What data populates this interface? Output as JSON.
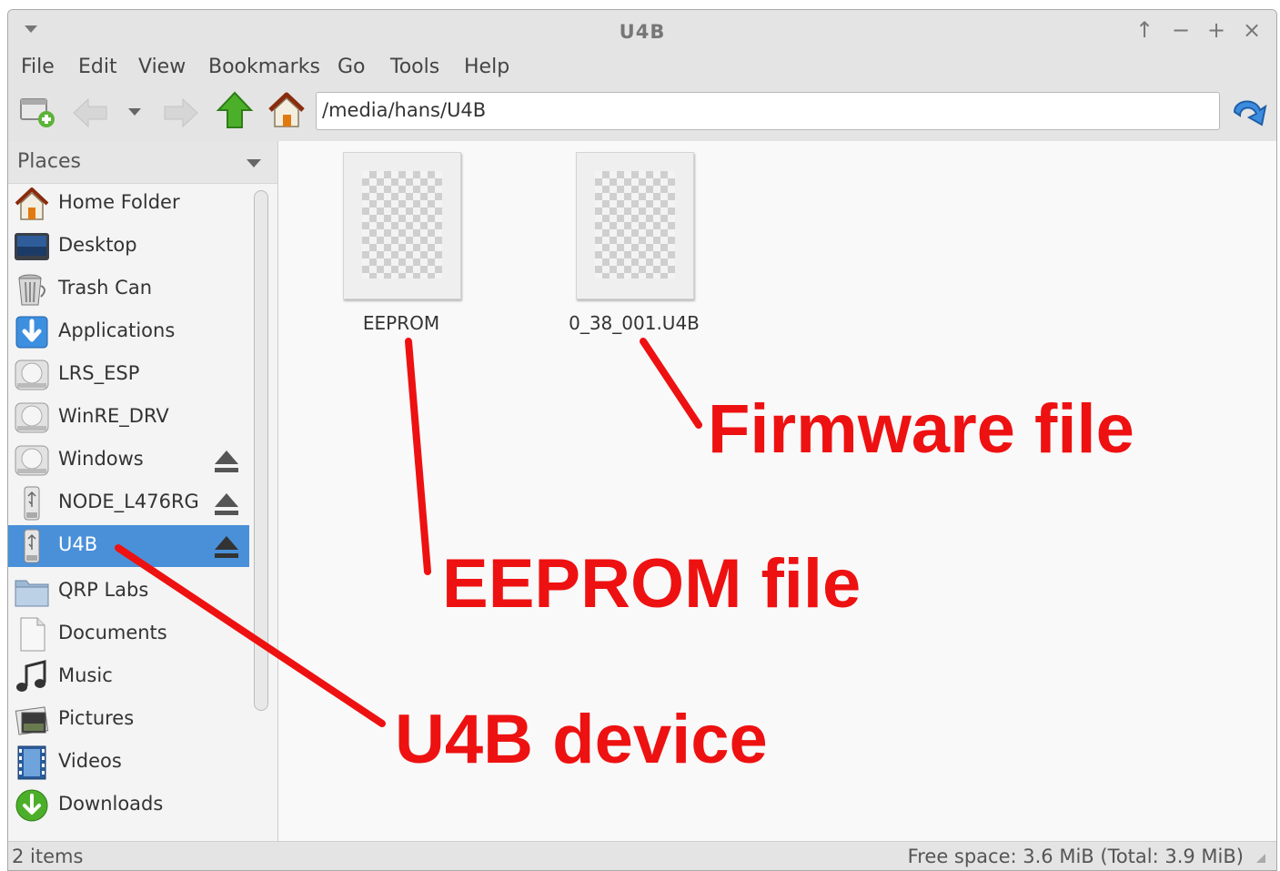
{
  "window": {
    "title": "U4B",
    "controls": [
      "↑",
      "−",
      "+",
      "×"
    ]
  },
  "menu": [
    "File",
    "Edit",
    "View",
    "Bookmarks",
    "Go",
    "Tools",
    "Help"
  ],
  "toolbar": {
    "address": "/media/hans/U4B",
    "icons": [
      "new-tab-icon",
      "back-icon",
      "history-dropdown-icon",
      "forward-icon",
      "up-icon",
      "home-icon",
      "go-icon"
    ]
  },
  "sidebar": {
    "title": "Places",
    "items": [
      {
        "label": "Home Folder",
        "icon": "home-icon"
      },
      {
        "label": "Desktop",
        "icon": "desktop-icon"
      },
      {
        "label": "Trash Can",
        "icon": "trash-icon"
      },
      {
        "label": "Applications",
        "icon": "applications-icon"
      },
      {
        "label": "LRS_ESP",
        "icon": "drive-icon"
      },
      {
        "label": "WinRE_DRV",
        "icon": "drive-icon"
      },
      {
        "label": "Windows",
        "icon": "drive-icon",
        "eject": true
      },
      {
        "label": "NODE_L476RG",
        "icon": "usb-icon",
        "eject": true
      },
      {
        "label": "U4B",
        "icon": "usb-icon",
        "eject": true,
        "selected": true
      },
      {
        "label": "QRP Labs",
        "icon": "folder-icon"
      },
      {
        "label": "Documents",
        "icon": "documents-icon"
      },
      {
        "label": "Music",
        "icon": "music-icon"
      },
      {
        "label": "Pictures",
        "icon": "pictures-icon"
      },
      {
        "label": "Videos",
        "icon": "videos-icon"
      },
      {
        "label": "Downloads",
        "icon": "downloads-icon"
      }
    ]
  },
  "files": [
    {
      "name": "EEPROM",
      "icon": "file-icon"
    },
    {
      "name": "0_38_001.U4B",
      "icon": "file-icon"
    }
  ],
  "status": {
    "items": "2 items",
    "free_space": "Free space: 3.6 MiB (Total: 3.9 MiB)"
  },
  "annotations": {
    "firmware": "Firmware file",
    "eeprom": "EEPROM file",
    "device": "U4B device",
    "color": "#ee1111"
  }
}
